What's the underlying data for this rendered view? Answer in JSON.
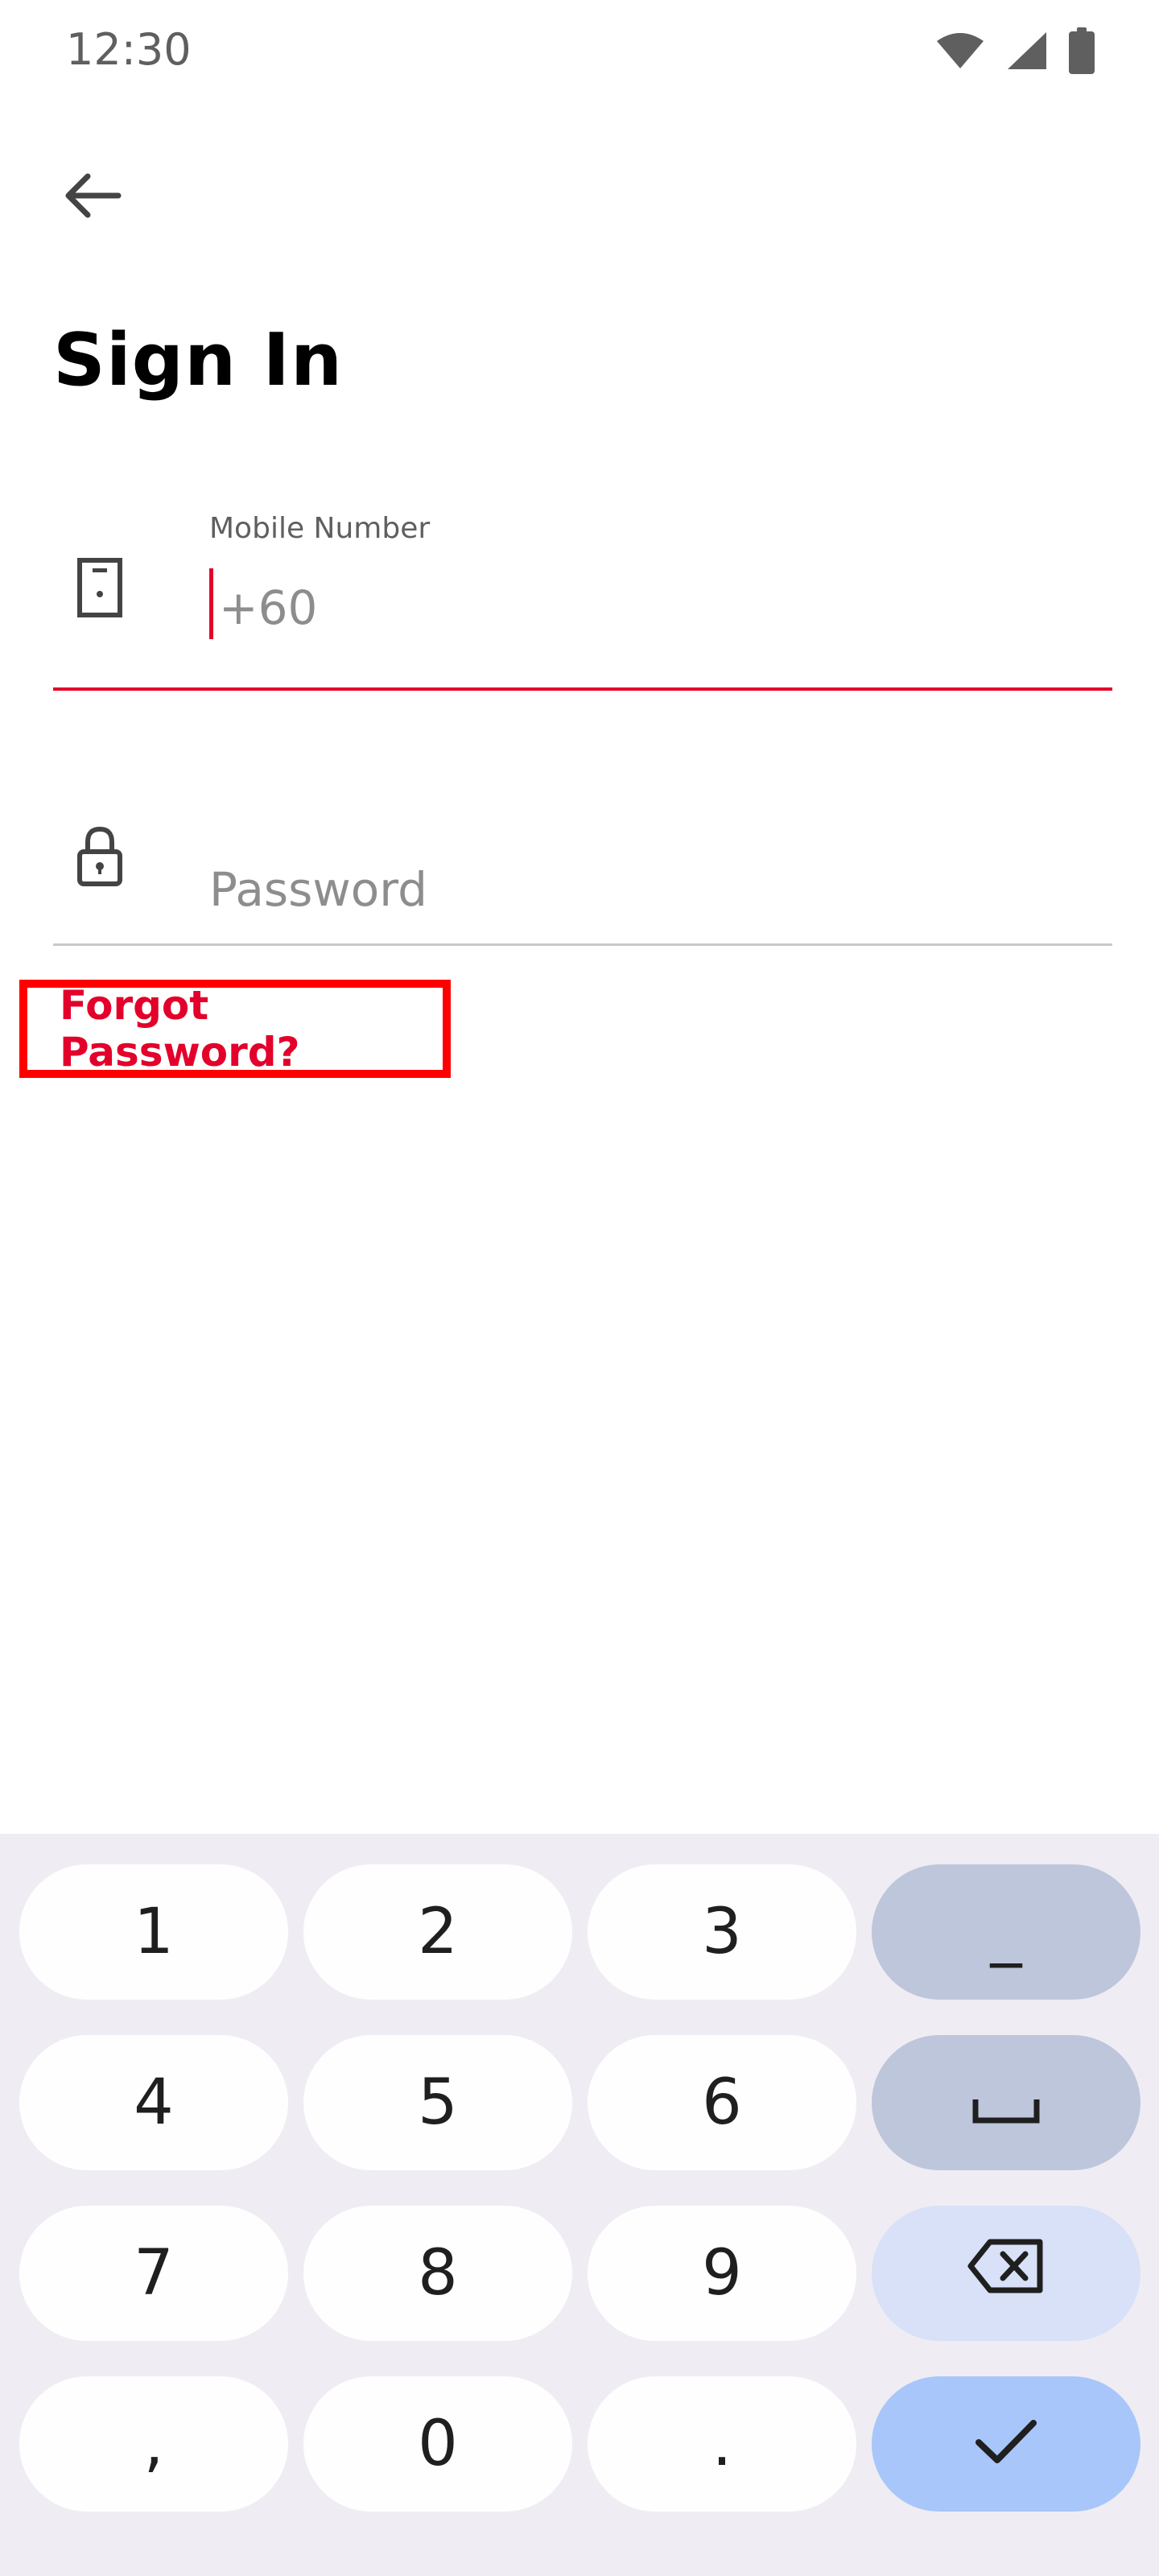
{
  "status_bar": {
    "time": "12:30",
    "icons": [
      "wifi-icon",
      "signal-icon",
      "battery-icon"
    ]
  },
  "header": {
    "back_icon": "arrow-left-icon",
    "title": "Sign In"
  },
  "form": {
    "mobile": {
      "label": "Mobile Number",
      "value": "",
      "placeholder": "+60",
      "icon": "phone-icon",
      "focused": true
    },
    "password": {
      "label": "",
      "value": "",
      "placeholder": "Password",
      "icon": "lock-icon"
    },
    "forgot_password": "Forgot Password?"
  },
  "keyboard": {
    "rows": [
      [
        "1",
        "2",
        "3",
        "_"
      ],
      [
        "4",
        "5",
        "6",
        "space"
      ],
      [
        "7",
        "8",
        "9",
        "backspace"
      ],
      [
        ",",
        "0",
        ".",
        "done"
      ]
    ],
    "keys": {
      "k1": "1",
      "k2": "2",
      "k3": "3",
      "underscore": "_",
      "k4": "4",
      "k5": "5",
      "k6": "6",
      "k7": "7",
      "k8": "8",
      "k9": "9",
      "comma": ",",
      "k0": "0",
      "period": "."
    }
  },
  "colors": {
    "accent": "#e3002b",
    "highlight_border": "#ff0000",
    "keyboard_bg": "#efedf3",
    "key_bg": "#fefefe",
    "fn_key_bg": "#bec6dc",
    "delete_key_bg": "#d8e1f7",
    "done_key_bg": "#a8c6f9"
  }
}
